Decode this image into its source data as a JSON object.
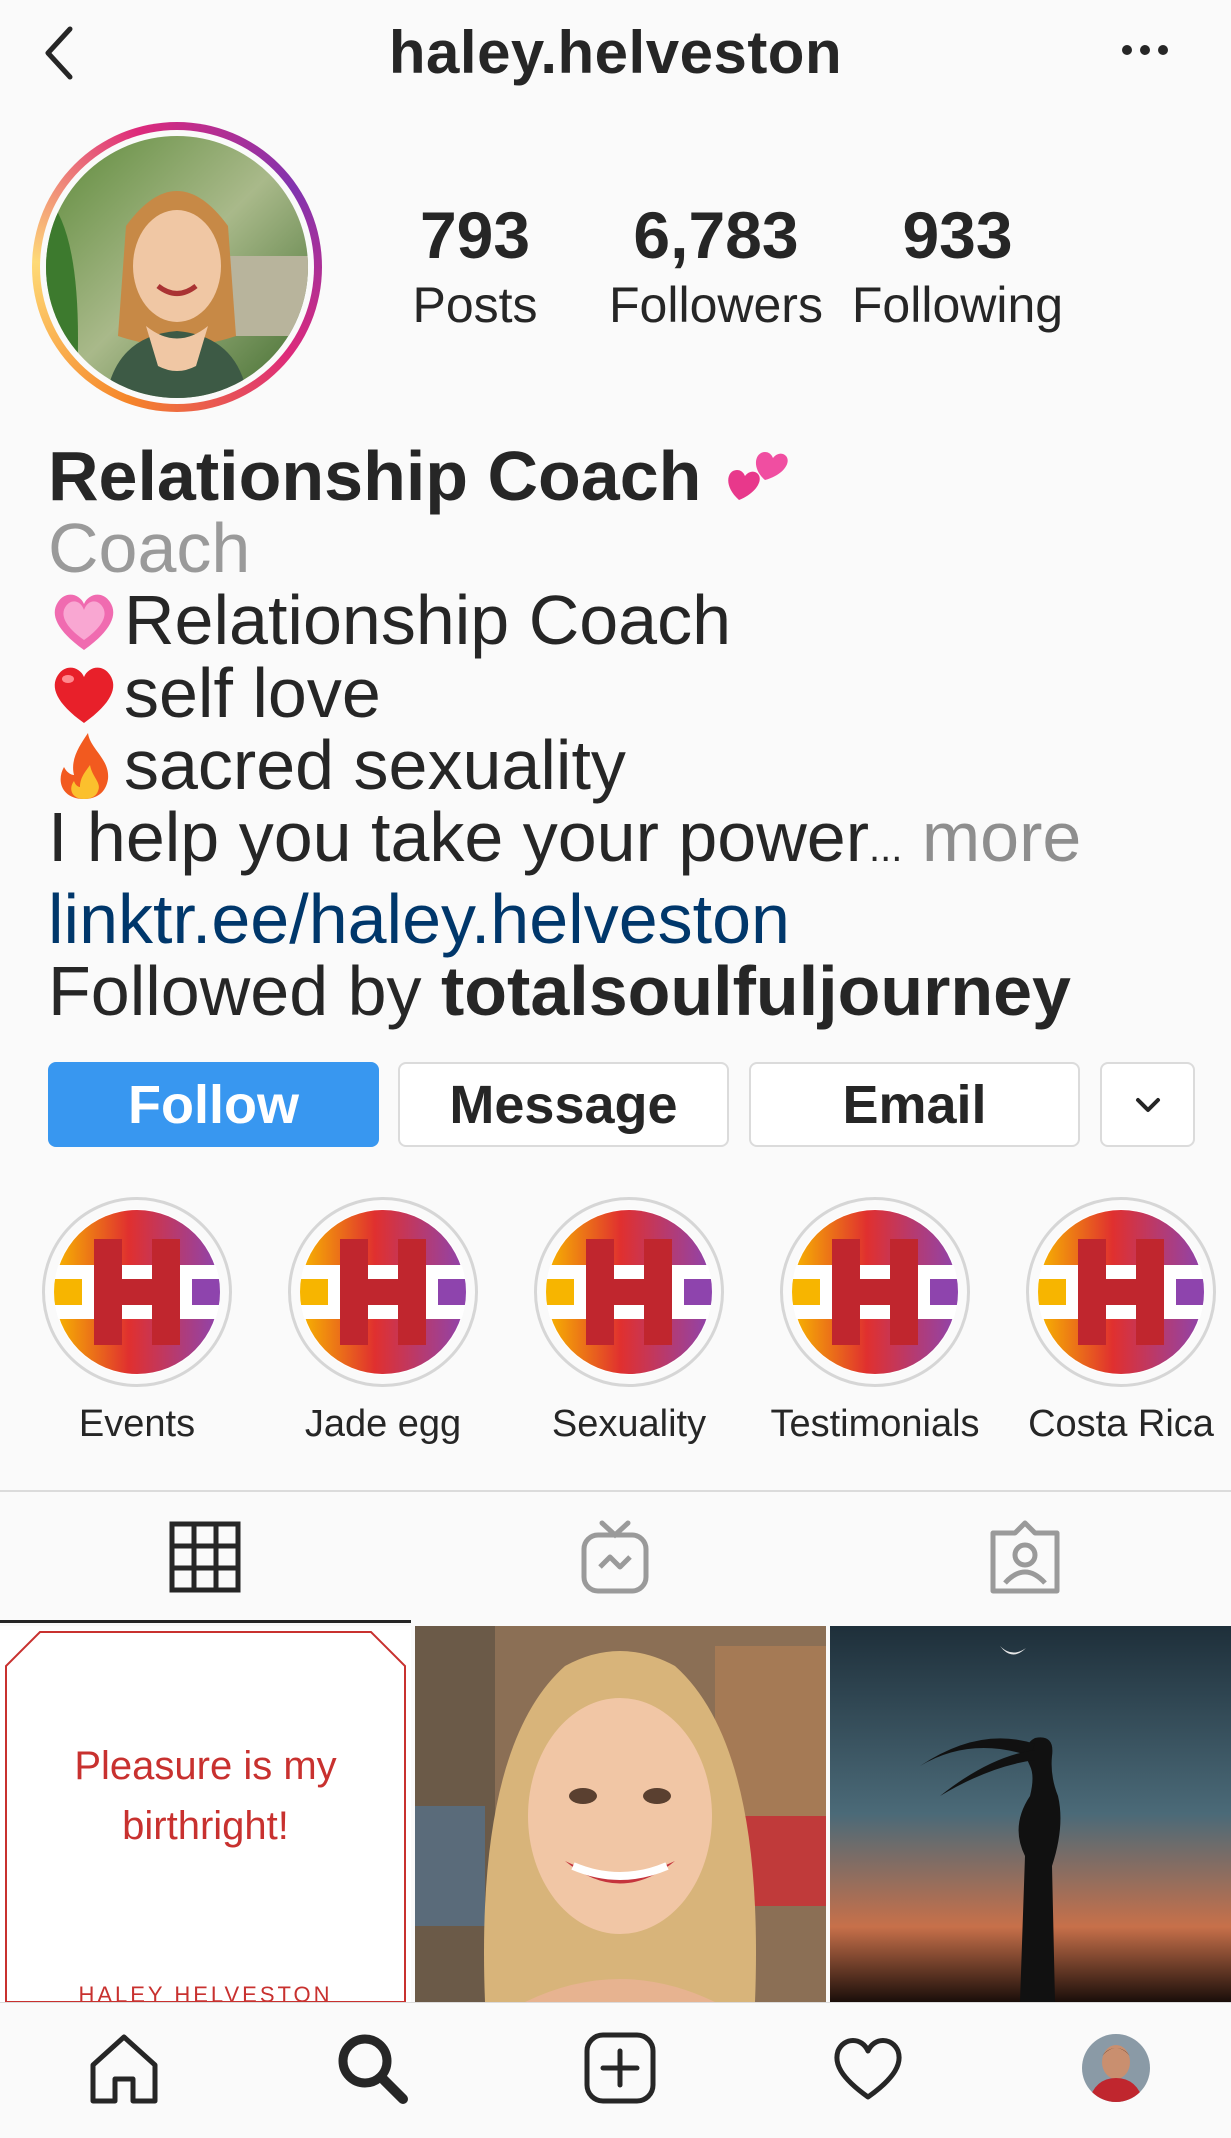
{
  "header": {
    "username": "haley.helveston",
    "back_icon": "chevron-left-icon",
    "more_icon": "more-horizontal-icon"
  },
  "stats": {
    "posts": {
      "value": "793",
      "label": "Posts"
    },
    "followers": {
      "value": "6,783",
      "label": "Followers"
    },
    "following": {
      "value": "933",
      "label": "Following"
    }
  },
  "bio": {
    "name": "Relationship Coach",
    "name_emoji": "two-hearts",
    "category": "Coach",
    "lines": [
      {
        "emoji": "growing-heart",
        "text": "Relationship Coach"
      },
      {
        "emoji": "red-heart",
        "text": "self love"
      },
      {
        "emoji": "fire",
        "text": "sacred sexuality"
      }
    ],
    "truncated_text": "I help you take your power",
    "ellipsis": "...",
    "more_label": "more",
    "link": "linktr.ee/haley.helveston",
    "followed_by_prefix": "Followed by ",
    "followed_by_user": "totalsoulfuljourney"
  },
  "actions": {
    "follow": "Follow",
    "message": "Message",
    "email": "Email",
    "dropdown_icon": "chevron-down-icon",
    "follow_color": "#3897f0"
  },
  "highlights": [
    {
      "label": "Events"
    },
    {
      "label": "Jade egg"
    },
    {
      "label": "Sexuality"
    },
    {
      "label": "Testimonials"
    },
    {
      "label": "Costa Rica"
    }
  ],
  "tabs": [
    {
      "icon": "grid-icon",
      "active": true
    },
    {
      "icon": "igtv-icon",
      "active": false
    },
    {
      "icon": "tagged-icon",
      "active": false
    }
  ],
  "posts": [
    {
      "type": "quote",
      "text_line1": "Pleasure is my",
      "text_line2": "birthright!",
      "footer": "HALEY HELVESTON",
      "text_color": "#c8312f"
    },
    {
      "type": "photo",
      "subject": "smiling-woman-portrait"
    },
    {
      "type": "photo",
      "subject": "silhouette-at-dusk"
    }
  ],
  "bottom_nav": [
    {
      "icon": "home-icon"
    },
    {
      "icon": "search-icon",
      "active": true
    },
    {
      "icon": "new-post-icon"
    },
    {
      "icon": "activity-heart-icon"
    },
    {
      "icon": "profile-avatar-icon"
    }
  ]
}
